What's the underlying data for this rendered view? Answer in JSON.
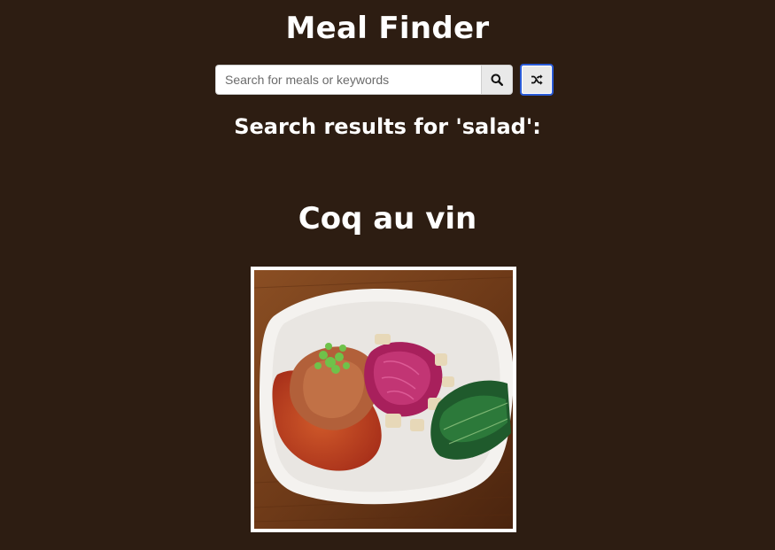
{
  "header": {
    "title": "Meal Finder"
  },
  "search": {
    "placeholder": "Search for meals or keywords",
    "value": "",
    "search_icon": "search-icon",
    "random_icon": "shuffle-icon"
  },
  "results": {
    "heading": "Search results for 'salad':",
    "meals": [
      {
        "name": "Coq au vin",
        "image_description_icon": "meal-photo"
      }
    ]
  },
  "colors": {
    "background": "#2d1d12",
    "text": "#ffffff",
    "focus_ring": "#2a5bd7",
    "button_bg": "#e9e9e9"
  }
}
